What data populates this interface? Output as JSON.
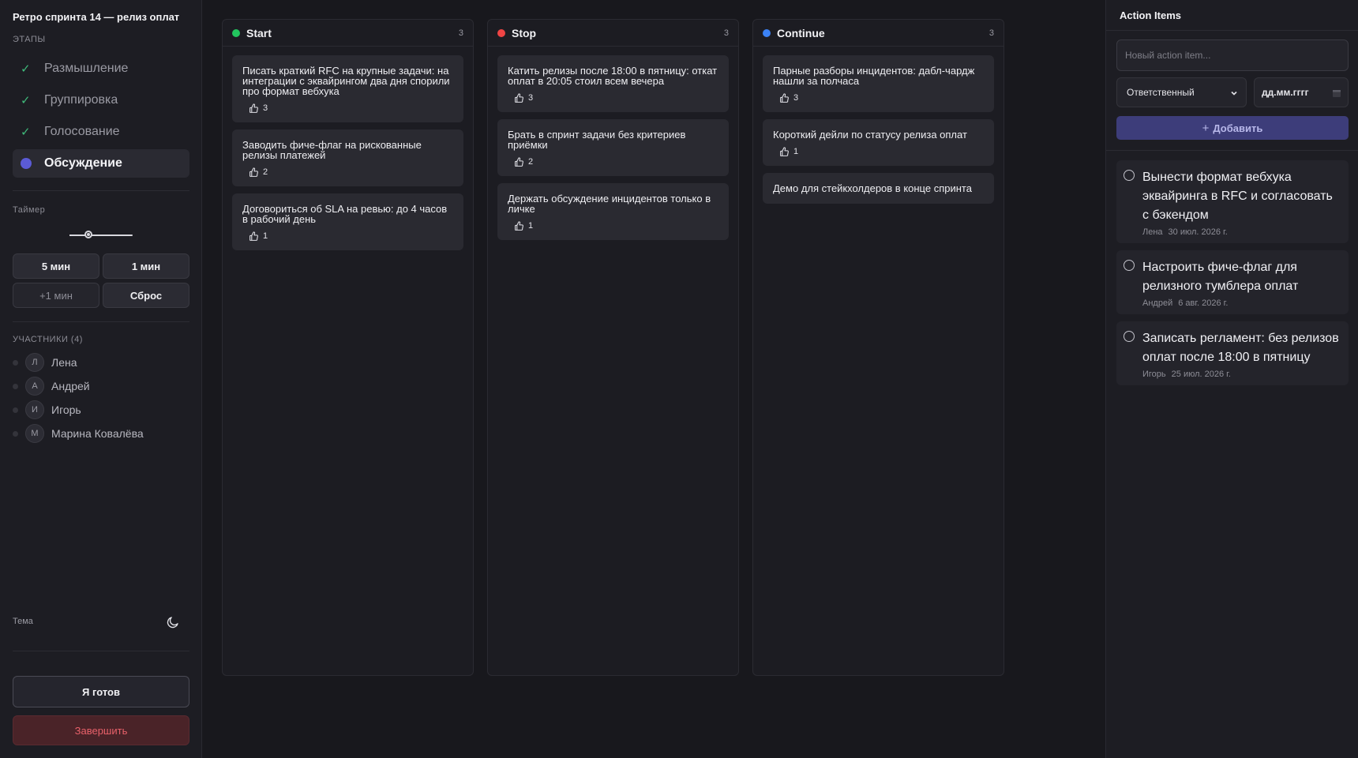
{
  "sidebar": {
    "title": "Ретро спринта 14 — релиз оплат",
    "stages_label": "ЭТАПЫ",
    "stages": [
      {
        "label": "Размышление",
        "state": "done"
      },
      {
        "label": "Группировка",
        "state": "done"
      },
      {
        "label": "Голосование",
        "state": "done"
      },
      {
        "label": "Обсуждение",
        "state": "active"
      }
    ],
    "timer_label": "Таймер",
    "timer_slider_fraction": 0.3,
    "timer_buttons": [
      "5 мин",
      "1 мин",
      "+1 мин",
      "Сброс"
    ],
    "participants_label": "УЧАСТНИКИ (4)",
    "participants": [
      {
        "initial": "Л",
        "name": "Лена"
      },
      {
        "initial": "А",
        "name": "Андрей"
      },
      {
        "initial": "И",
        "name": "Игорь"
      },
      {
        "initial": "М",
        "name": "Марина Ковалёва"
      }
    ],
    "theme_label": "Тема",
    "theme_icon": "moon-icon",
    "ready_button": "Я готов",
    "finish_button": "Завершить"
  },
  "board": {
    "columns": [
      {
        "title": "Start",
        "count": "3",
        "color": "#22c55e",
        "cards": [
          {
            "text": "Писать краткий RFC на крупные задачи: на интеграции с эквайрингом два дня спорили про формат вебхука",
            "votes": "3"
          },
          {
            "text": "Заводить фиче-флаг на рискованные релизы платежей",
            "votes": "2"
          },
          {
            "text": "Договориться об SLA на ревью: до 4 часов в рабочий день",
            "votes": "1"
          }
        ]
      },
      {
        "title": "Stop",
        "count": "3",
        "color": "#ef4444",
        "cards": [
          {
            "text": "Катить релизы после 18:00 в пятницу: откат оплат в 20:05 стоил всем вечера",
            "votes": "3"
          },
          {
            "text": "Брать в спринт задачи без критериев приёмки",
            "votes": "2"
          },
          {
            "text": "Держать обсуждение инцидентов только в личке",
            "votes": "1"
          }
        ]
      },
      {
        "title": "Continue",
        "count": "3",
        "color": "#3b82f6",
        "cards": [
          {
            "text": "Парные разборы инцидентов: дабл-чардж нашли за полчаса",
            "votes": "3"
          },
          {
            "text": "Короткий дейли по статусу релиза оплат",
            "votes": "1"
          },
          {
            "text": "Демо для стейкхолдеров в конце спринта",
            "votes": ""
          }
        ]
      }
    ]
  },
  "actions": {
    "title": "Action Items",
    "input_placeholder": "Новый action item...",
    "assignee_placeholder": "Ответственный",
    "date_placeholder": "дд.мм.гггг",
    "add_button": "Добавить",
    "items": [
      {
        "text": "Вынести формат вебхука эквайринга в RFC и согласовать с бэкендом",
        "owner": "Лена",
        "date": "30 июл. 2026 г."
      },
      {
        "text": "Настроить фиче-флаг для релизного тумблера оплат",
        "owner": "Андрей",
        "date": "6 авг. 2026 г."
      },
      {
        "text": "Записать регламент: без релизов оплат после 18:00 в пятницу",
        "owner": "Игорь",
        "date": "25 июл. 2026 г."
      }
    ]
  }
}
